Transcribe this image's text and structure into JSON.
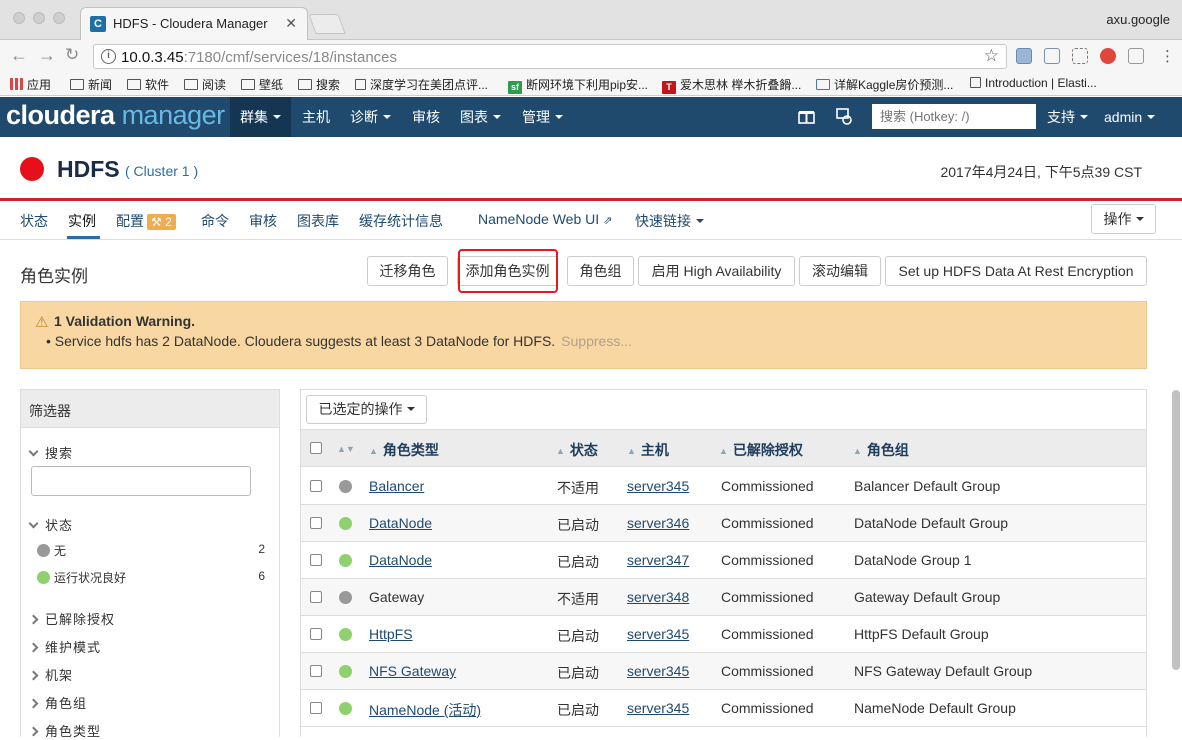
{
  "browser": {
    "tab_title": "HDFS - Cloudera Manager",
    "tab_favicon": "C",
    "profile": "axu.google",
    "url_host": "10.0.3.45",
    "url_path": ":7180/cmf/services/18/instances",
    "bookmarks": [
      "应用",
      "新闻",
      "软件",
      "阅读",
      "壁纸",
      "搜索",
      "深度学习在美团点评...",
      "断网环境下利用pip安...",
      "爱木思林 榉木折叠餶...",
      "详解Kaggle房价预测...",
      "Introduction | Elasti..."
    ]
  },
  "navbar": {
    "logo_main": "cloudera",
    "logo_sub": "manager",
    "items": [
      "群集",
      "主机",
      "诊断",
      "审核",
      "图表",
      "管理"
    ],
    "search_placeholder": "搜索 (Hotkey: /)",
    "support": "支持",
    "user": "admin",
    "bg_color": "#1f4a6e"
  },
  "service": {
    "name": "HDFS",
    "cluster": "( Cluster 1 )",
    "datetime": "2017年4月24日, 下午5点39 CST",
    "status_color": "#e5101a"
  },
  "subtabs": {
    "items": [
      "状态",
      "实例",
      "配置",
      "命令",
      "审核",
      "图表库",
      "缓存统计信息"
    ],
    "config_badge": "2",
    "namenode_ui": "NameNode Web UI",
    "quick_links": "快速链接",
    "actions": "操作",
    "active": "实例"
  },
  "page": {
    "title": "角色实例",
    "buttons": [
      "迁移角色",
      "添加角色实例",
      "角色组",
      "启用 High Availability",
      "滚动编辑",
      "Set up HDFS Data At Rest Encryption"
    ]
  },
  "warning": {
    "title": "1 Validation Warning.",
    "message": "Service hdfs has 2 DataNode. Cloudera suggests at least 3 DataNode for HDFS.",
    "suppress": "Suppress..."
  },
  "filters": {
    "header": "筛选器",
    "search_label": "搜索",
    "status_label": "状态",
    "status_items": [
      {
        "label": "无",
        "count": "2",
        "color": "#999999"
      },
      {
        "label": "运行状况良好",
        "count": "6",
        "color": "#8fd16f"
      }
    ],
    "sections": [
      "已解除授权",
      "维护模式",
      "机架",
      "角色组",
      "角色类型"
    ]
  },
  "table": {
    "selected_actions": "已选定的操作",
    "columns": [
      "角色类型",
      "状态",
      "主机",
      "已解除授权",
      "角色组"
    ],
    "rows": [
      {
        "role": "Balancer",
        "status": "不适用",
        "host": "server345",
        "decom": "Commissioned",
        "group": "Balancer Default Group",
        "dot": "#999999",
        "link": true
      },
      {
        "role": "DataNode",
        "status": "已启动",
        "host": "server346",
        "decom": "Commissioned",
        "group": "DataNode Default Group",
        "dot": "#8fd16f",
        "link": true
      },
      {
        "role": "DataNode",
        "status": "已启动",
        "host": "server347",
        "decom": "Commissioned",
        "group": "DataNode Group 1",
        "dot": "#8fd16f",
        "link": true
      },
      {
        "role": "Gateway",
        "status": "不适用",
        "host": "server348",
        "decom": "Commissioned",
        "group": "Gateway Default Group",
        "dot": "#999999",
        "link": false
      },
      {
        "role": "HttpFS",
        "status": "已启动",
        "host": "server345",
        "decom": "Commissioned",
        "group": "HttpFS Default Group",
        "dot": "#8fd16f",
        "link": true
      },
      {
        "role": "NFS Gateway",
        "status": "已启动",
        "host": "server345",
        "decom": "Commissioned",
        "group": "NFS Gateway Default Group",
        "dot": "#8fd16f",
        "link": true
      },
      {
        "role": "NameNode (活动)",
        "status": "已启动",
        "host": "server345",
        "decom": "Commissioned",
        "group": "NameNode Default Group",
        "dot": "#8fd16f",
        "link": true
      }
    ]
  }
}
